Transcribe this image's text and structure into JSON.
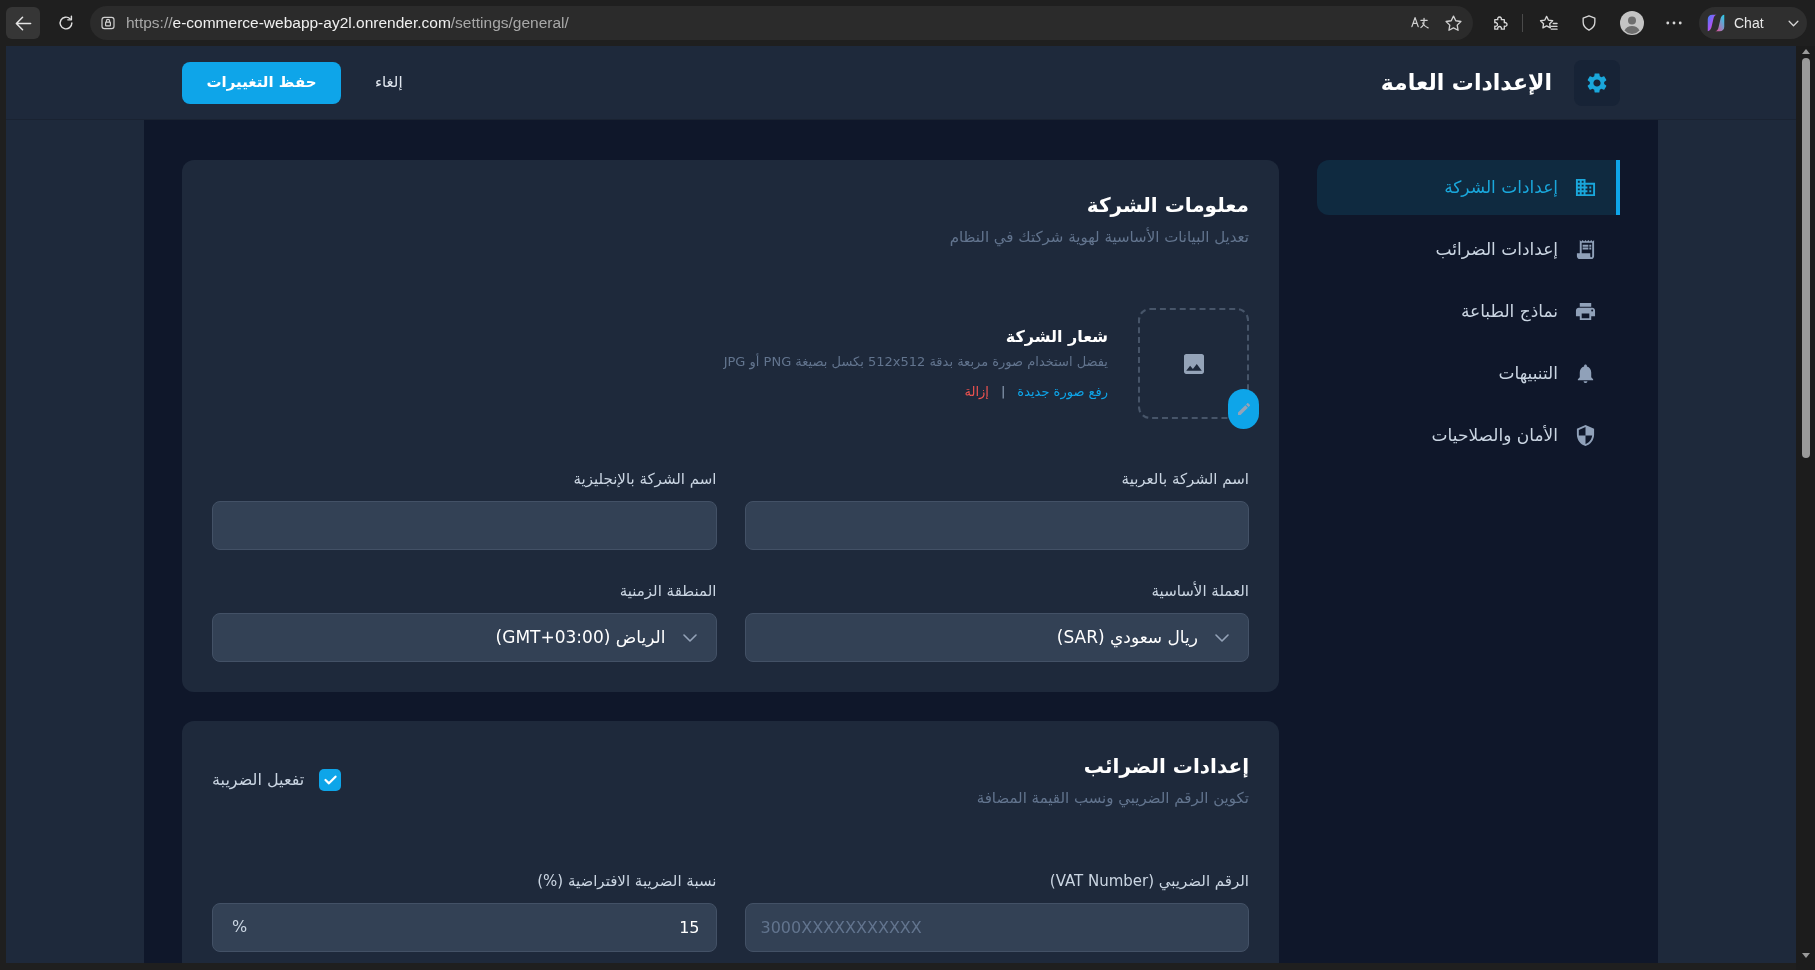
{
  "browser": {
    "url": {
      "scheme": "https://",
      "host": "e-commerce-webapp-ay2l.onrender.com",
      "path": "/settings/general/"
    },
    "chat_button": "Chat"
  },
  "header": {
    "title": "الإعدادات العامة",
    "buttons": [
      {
        "label": "إلغاء",
        "kind": "plain"
      },
      {
        "label": "حفظ التغييرات",
        "kind": "primary"
      }
    ]
  },
  "sidebar": {
    "items": [
      {
        "label": "إعدادات الشركة",
        "selected": true
      },
      {
        "label": "إعدادات الضرائب",
        "selected": false
      },
      {
        "label": "نماذج الطباعة",
        "selected": false
      },
      {
        "label": "التنبيهات",
        "selected": false
      },
      {
        "label": "الأمان والصلاحيات",
        "selected": false
      }
    ]
  },
  "sections": [
    {
      "title": "معلومات الشركة",
      "subtitle": "تعديل البيانات الأساسية لهوية شركتك في النظام",
      "logo": {
        "title": "شعار الشركة",
        "hint": "يفضل استخدام صورة مربعة بدقة 512x512 بكسل بصيغة PNG أو JPG",
        "upload_link": "رفع صورة جديدة",
        "separator": "|",
        "remove_link": "إزالة"
      },
      "fields": [
        {
          "label": "اسم الشركة بالعربية",
          "kind": "text"
        },
        {
          "label": "اسم الشركة بالإنجليزية",
          "kind": "text"
        },
        {
          "label": "العملة الأساسية",
          "kind": "select",
          "value": "ريال سعودي (SAR)"
        },
        {
          "label": "المنطقة الزمنية",
          "kind": "select",
          "value": "الرياض (GMT+03:00)"
        }
      ]
    },
    {
      "title": "إعدادات الضرائب",
      "subtitle": "تكوين الرقم الضريبي ونسب القيمة المضافة",
      "toggle": {
        "label": "تفعيل الضريبة",
        "checked": true
      },
      "fields": [
        {
          "label": "الرقم الضريبي (VAT Number)",
          "kind": "code",
          "placeholder": "3000XXXXXXXXXXX"
        },
        {
          "label": "نسبة الضريبة الافتراضية (%)",
          "kind": "number",
          "value": "15",
          "suffix": "%"
        }
      ]
    }
  ]
}
